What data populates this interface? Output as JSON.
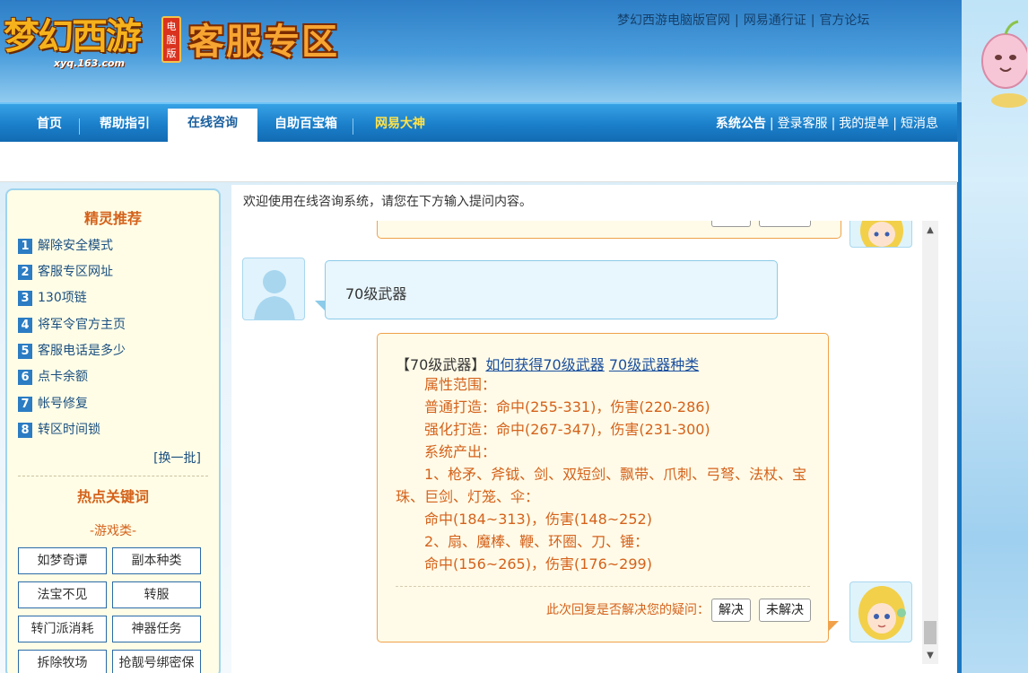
{
  "header": {
    "logo_text": "梦幻西游",
    "logo_url_text": "xyq.163.com",
    "logo_badge": "电脑版",
    "zone_title": "客服专区",
    "top_links": [
      "梦幻西游电脑版官网",
      "网易通行证",
      "官方论坛"
    ]
  },
  "nav": {
    "items": [
      "首页",
      "帮助指引",
      "在线咨询",
      "自助百宝箱",
      "网易大神"
    ],
    "active_index": 2,
    "right_links": [
      "系统公告",
      "登录客服",
      "我的提单",
      "短消息"
    ],
    "highlight_color": "#ffe24a"
  },
  "sidebar": {
    "title": "精灵推荐",
    "recommendations": [
      {
        "num": "1",
        "label": "解除安全模式"
      },
      {
        "num": "2",
        "label": "客服专区网址"
      },
      {
        "num": "3",
        "label": "130项链"
      },
      {
        "num": "4",
        "label": "将军令官方主页"
      },
      {
        "num": "5",
        "label": "客服电话是多少"
      },
      {
        "num": "6",
        "label": "点卡余额"
      },
      {
        "num": "7",
        "label": "帐号修复"
      },
      {
        "num": "8",
        "label": "转区时间锁"
      }
    ],
    "refresh_label": "[换一批]",
    "hot_title": "热点关键词",
    "category": "-游戏类-",
    "keywords": [
      "如梦奇谭",
      "副本种类",
      "法宝不见",
      "转服",
      "转门派消耗",
      "神器任务",
      "拆除牧场",
      "抢靓号绑密保"
    ]
  },
  "main": {
    "welcome": "欢迎使用在线咨询系统，请您在下方输入提问内容。",
    "user_message": "70级武器",
    "reply": {
      "head_bracket": "【70级武器】",
      "link1": "如何获得70级武器",
      "link2": "70级武器种类",
      "lines": [
        "属性范围：",
        "普通打造：命中(255-331)，伤害(220-286)",
        "强化打造：命中(267-347)，伤害(231-300)",
        "系统产出：",
        "1、枪矛、斧钺、剑、双短剑、飘带、爪刺、弓弩、法杖、宝",
        "珠、巨剑、灯笼、伞：",
        "命中(184~313)，伤害(148~252)",
        "2、扇、魔棒、鞭、环圈、刀、锤：",
        "命中(156~265)，伤害(176~299)"
      ],
      "resolve_question": "此次回复是否解决您的疑问：",
      "resolved_label": "解决",
      "unresolved_label": "未解决"
    }
  }
}
